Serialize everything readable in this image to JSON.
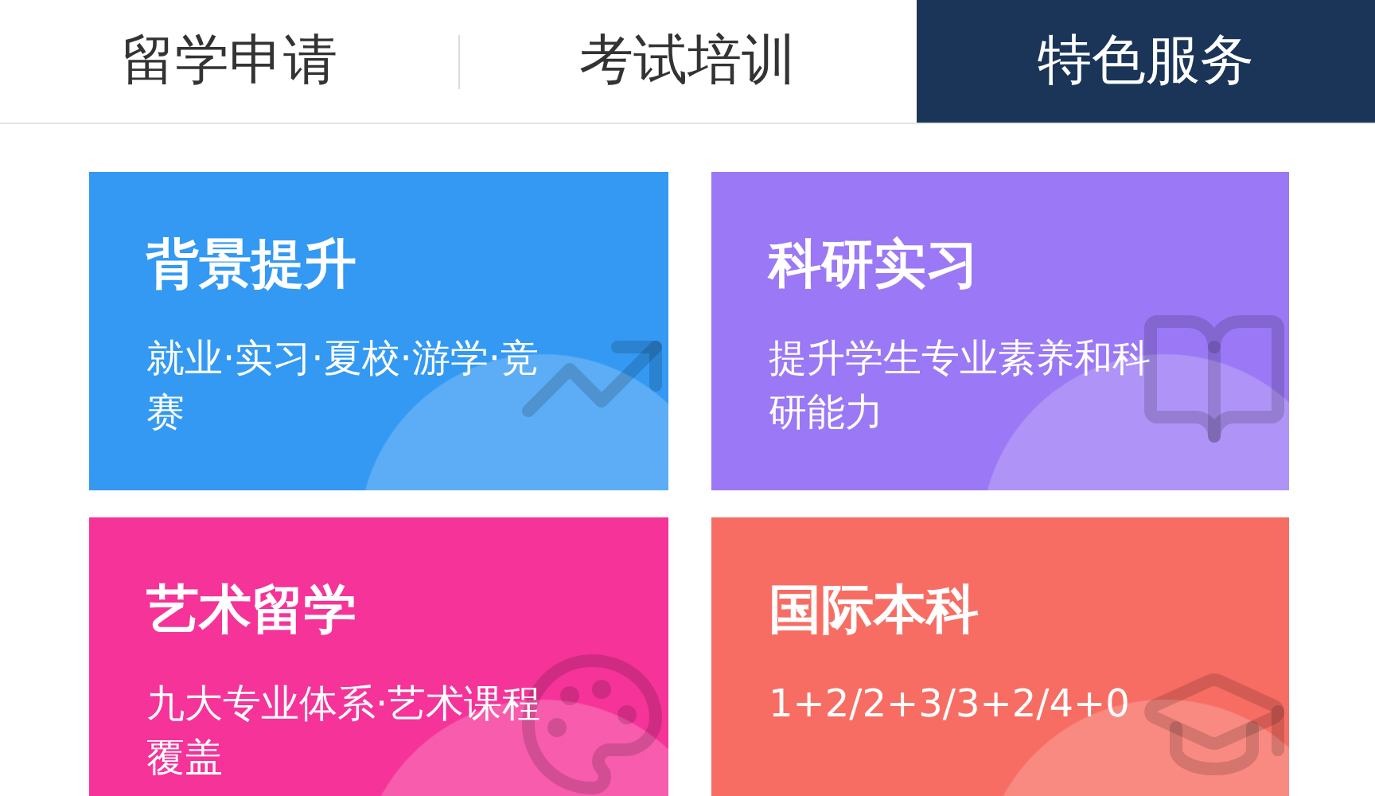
{
  "tabs": [
    {
      "label": "留学申请",
      "selected": false
    },
    {
      "label": "考试培训",
      "selected": false
    },
    {
      "label": "特色服务",
      "selected": true
    }
  ],
  "cards": [
    {
      "kind": "chart",
      "title": "背景提升",
      "subtitle": "就业·实习·夏校·游学·竞赛",
      "color": "#3399f3"
    },
    {
      "kind": "book",
      "title": "科研实习",
      "subtitle": "提升学生专业素养和科研能力",
      "color": "#9b78f5"
    },
    {
      "kind": "palette",
      "title": "艺术留学",
      "subtitle": "九大专业体系·艺术课程覆盖",
      "color": "#f53399"
    },
    {
      "kind": "cap",
      "title": "国际本科",
      "subtitle": "1+2/2+3/3+2/4+0",
      "color": "#f76d63"
    }
  ]
}
